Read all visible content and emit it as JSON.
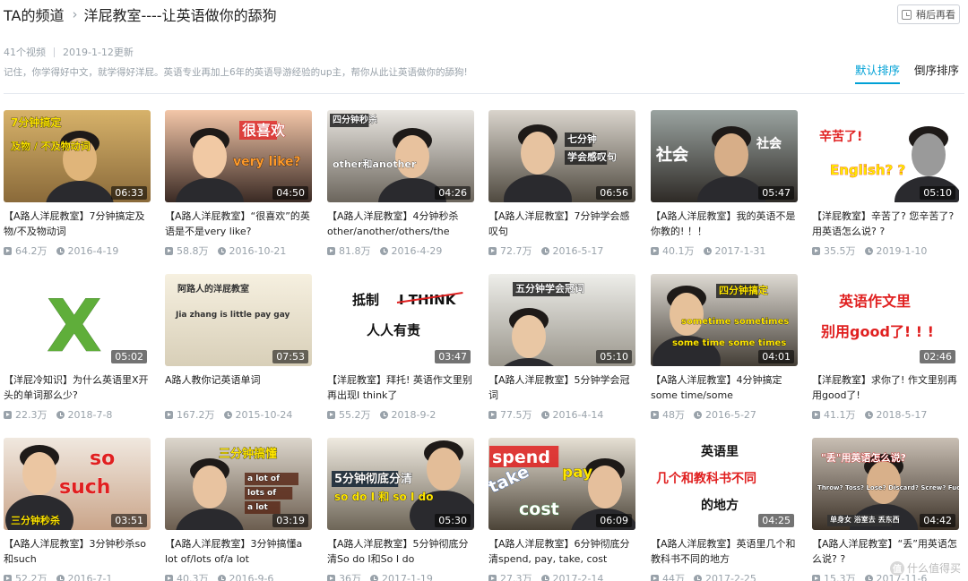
{
  "header": {
    "channel": "TA的频道",
    "title": "洋屁教室----让英语做你的舔狗",
    "watch_later": "稍后再看"
  },
  "meta": {
    "count": "41个视频",
    "updated": "2019-1-12更新",
    "description": "记住，你学得好中文，就学得好洋屁。英语专业再加上6年的英语导游经验的up主，帮你从此让英语做你的舔狗!"
  },
  "sort": {
    "default": "默认排序",
    "reverse": "倒序排序"
  },
  "colors": {
    "accent": "#00a1d6",
    "meta": "#99a2aa"
  },
  "videos": [
    {
      "duration": "06:33",
      "title": "【A路人洋屁教室】7分钟搞定及物/不及物动词",
      "views": "64.2万",
      "date": "2016-4-19",
      "thumb_text": [
        "7分钟搞定",
        "及物 / 不及物动词"
      ]
    },
    {
      "duration": "04:50",
      "title": "【A路人洋屁教室】“很喜欢”的英语是不是very like?",
      "views": "58.8万",
      "date": "2016-10-21",
      "thumb_text": [
        "很喜欢",
        "very like?"
      ]
    },
    {
      "duration": "04:26",
      "title": "【A路人洋屁教室】4分钟秒杀other/another/others/the",
      "views": "81.8万",
      "date": "2016-4-29",
      "thumb_text": [
        "四分钟秒杀",
        "other和another"
      ]
    },
    {
      "duration": "06:56",
      "title": "【A路人洋屁教室】7分钟学会感叹句",
      "views": "72.7万",
      "date": "2016-5-17",
      "thumb_text": [
        "七分钟",
        "学会感叹句"
      ]
    },
    {
      "duration": "05:47",
      "title": "【A路人洋屁教室】我的英语不是你教的! ！！",
      "views": "40.1万",
      "date": "2017-1-31",
      "thumb_text": [
        "社会",
        "社会"
      ]
    },
    {
      "duration": "05:10",
      "title": "【洋屁教室】辛苦了? 您辛苦了?用英语怎么说? ?",
      "views": "35.5万",
      "date": "2019-1-10",
      "thumb_text": [
        "辛苦了!",
        "English? ?"
      ]
    },
    {
      "duration": "05:02",
      "title": "【洋屁冷知识】为什么英语里X开头的单词那么少?",
      "views": "22.3万",
      "date": "2018-7-8",
      "thumb_text": [
        "X"
      ]
    },
    {
      "duration": "07:53",
      "title": "A路人教你记英语单词",
      "views": "167.2万",
      "date": "2015-10-24",
      "thumb_text": [
        "阿路人的洋屁教室",
        "Jia zhang is little pay gay"
      ]
    },
    {
      "duration": "03:47",
      "title": "【洋屁教室】拜托! 英语作文里别再出现I think了",
      "views": "55.2万",
      "date": "2018-9-2",
      "thumb_text": [
        "抵制",
        "I THINK",
        "人人有责"
      ]
    },
    {
      "duration": "05:10",
      "title": "【A路人洋屁教室】5分钟学会冠词",
      "views": "77.5万",
      "date": "2016-4-14",
      "thumb_text": [
        "五分钟学会冠词"
      ]
    },
    {
      "duration": "04:01",
      "title": "【A路人洋屁教室】4分钟搞定some time/some",
      "views": "48万",
      "date": "2016-5-27",
      "thumb_text": [
        "四分钟搞定",
        "sometime sometimes",
        "some time some times"
      ]
    },
    {
      "duration": "02:46",
      "title": "【洋屁教室】求你了! 作文里别再用good了!",
      "views": "41.1万",
      "date": "2018-5-17",
      "thumb_text": [
        "英语作文里",
        "别用good了! ! !"
      ]
    },
    {
      "duration": "03:51",
      "title": "【A路人洋屁教室】3分钟秒杀so和such",
      "views": "52.2万",
      "date": "2016-7-1",
      "thumb_text": [
        "so",
        "such",
        "三分钟秒杀"
      ]
    },
    {
      "duration": "03:19",
      "title": "【A路人洋屁教室】3分钟搞懂a lot of/lots of/a lot",
      "views": "40.3万",
      "date": "2016-9-6",
      "thumb_text": [
        "三分钟搞懂",
        "a lot of",
        "lots of",
        "a lot"
      ]
    },
    {
      "duration": "05:30",
      "title": "【A路人洋屁教室】5分钟彻底分清So do I和So I do",
      "views": "36万",
      "date": "2017-1-19",
      "thumb_text": [
        "5分钟彻底分清",
        "so do I 和 so I do"
      ]
    },
    {
      "duration": "06:09",
      "title": "【A路人洋屁教室】6分钟彻底分清spend, pay, take, cost",
      "views": "27.3万",
      "date": "2017-2-14",
      "thumb_text": [
        "spend",
        "take",
        "pay",
        "cost"
      ]
    },
    {
      "duration": "04:25",
      "title": "【A路人洋屁教室】英语里几个和教科书不同的地方",
      "views": "44万",
      "date": "2017-2-25",
      "thumb_text": [
        "英语里",
        "几个和教科书不同",
        "的地方"
      ]
    },
    {
      "duration": "04:42",
      "title": "【A路人洋屁教室】“丢”用英语怎么说? ?",
      "views": "15.3万",
      "date": "2017-11-6",
      "thumb_text": [
        "\"丢\"用英语怎么说?",
        "Throw? Toss? Lose? Discard? Screw? Fuck?",
        "单身女 浴室去 丢东西"
      ]
    }
  ],
  "watermark": {
    "badge": "值",
    "text": "什么值得买"
  }
}
